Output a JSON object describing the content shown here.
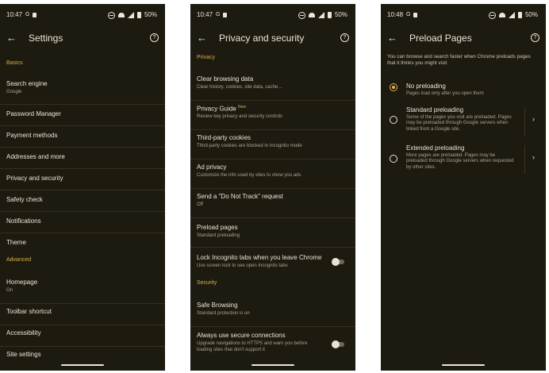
{
  "screens": [
    {
      "status": {
        "time": "10:47",
        "battery": "50%"
      },
      "title": "Settings",
      "section_basics": "Basics",
      "section_advanced": "Advanced",
      "items": [
        {
          "title": "Search engine",
          "subtitle": "Google"
        },
        {
          "title": "Password Manager"
        },
        {
          "title": "Payment methods"
        },
        {
          "title": "Addresses and more"
        },
        {
          "title": "Privacy and security"
        },
        {
          "title": "Safety check"
        },
        {
          "title": "Notifications"
        },
        {
          "title": "Theme"
        },
        {
          "title": "Homepage",
          "subtitle": "On"
        },
        {
          "title": "Toolbar shortcut"
        },
        {
          "title": "Accessibility"
        },
        {
          "title": "Site settings"
        }
      ]
    },
    {
      "status": {
        "time": "10:47",
        "battery": "50%"
      },
      "title": "Privacy and security",
      "section_privacy": "Privacy",
      "section_security": "Security",
      "new_badge": "New",
      "items": [
        {
          "title": "Clear browsing data",
          "subtitle": "Clear history, cookies, site data, cache…"
        },
        {
          "title": "Privacy Guide",
          "subtitle": "Review key privacy and security controls"
        },
        {
          "title": "Third-party cookies",
          "subtitle": "Third-party cookies are blocked in Incognito mode"
        },
        {
          "title": "Ad privacy",
          "subtitle": "Customize the info used by sites to show you ads"
        },
        {
          "title": "Send a \"Do Not Track\" request",
          "subtitle": "Off"
        },
        {
          "title": "Preload pages",
          "subtitle": "Standard preloading"
        },
        {
          "title": "Lock Incognito tabs when you leave Chrome",
          "subtitle": "Use screen lock to see open Incognito tabs"
        },
        {
          "title": "Safe Browsing",
          "subtitle": "Standard protection is on"
        },
        {
          "title": "Always use secure connections",
          "subtitle": "Upgrade navigations to HTTPS and warn you before loading sites that don't support it"
        }
      ]
    },
    {
      "status": {
        "time": "10:48",
        "battery": "50%"
      },
      "title": "Preload Pages",
      "intro": "You can browse and search faster when Chrome preloads pages that it thinks you might visit",
      "options": [
        {
          "title": "No preloading",
          "subtitle": "Pages load only after you open them",
          "selected": true
        },
        {
          "title": "Standard preloading",
          "subtitle": "Some of the pages you visit are preloaded. Pages may be preloaded through Google servers when linked from a Google site.",
          "selected": false
        },
        {
          "title": "Extended preloading",
          "subtitle": "More pages are preloaded. Pages may be preloaded through Google servers when requested by other sites.",
          "selected": false
        }
      ]
    }
  ],
  "colors": {
    "background": "#1d1a0f",
    "accent": "#d9b04f",
    "text": "#ebe6d8",
    "subtext": "#aba591"
  }
}
